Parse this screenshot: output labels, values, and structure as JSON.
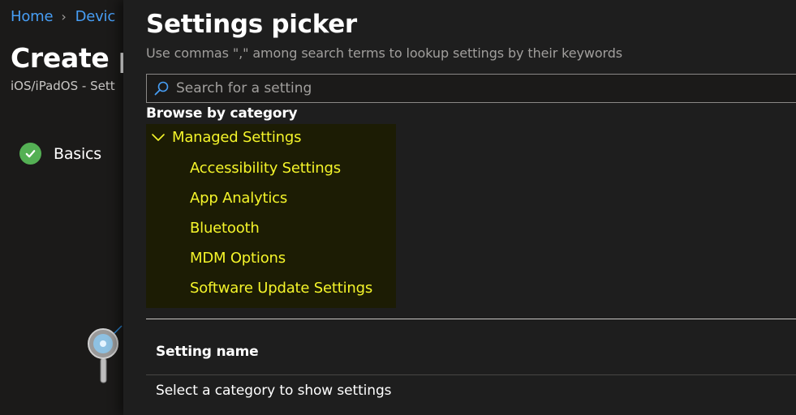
{
  "breadcrumb": {
    "items": [
      "Home",
      "Devic"
    ]
  },
  "background": {
    "title": "Create p",
    "subtitle": "iOS/iPadOS - Sett",
    "steps": [
      {
        "label": "Basics",
        "status": "complete"
      }
    ]
  },
  "picker": {
    "title": "Settings picker",
    "description": "Use commas \",\" among search terms to lookup settings by their keywords",
    "search": {
      "placeholder": "Search for a setting",
      "value": ""
    },
    "browse_label": "Browse by category",
    "tree": {
      "root": {
        "label": "Managed Settings",
        "expanded": true,
        "icon": "chevron-down-icon"
      },
      "children": [
        {
          "label": "Accessibility Settings"
        },
        {
          "label": "App Analytics"
        },
        {
          "label": "Bluetooth"
        },
        {
          "label": "MDM Options"
        },
        {
          "label": "Software Update Settings"
        }
      ]
    },
    "table": {
      "column_header": "Setting name",
      "empty_message": "Select a category to show settings"
    }
  },
  "colors": {
    "link": "#479ef5",
    "highlight_text": "#f5f52a",
    "highlight_bg": "#1c1c04",
    "success": "#54b054"
  }
}
